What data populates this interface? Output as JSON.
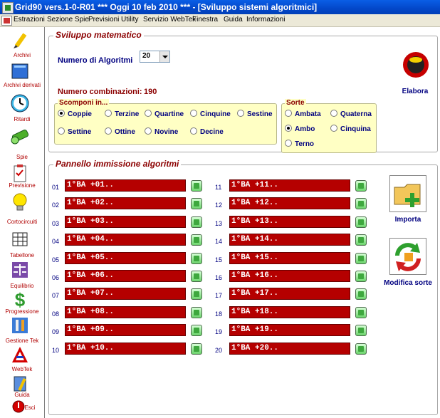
{
  "window": {
    "title": "Grid90 vers.1-0-R01  ***  Oggi 10 feb 2010  ***   - [Sviluppo sistemi algoritmici]"
  },
  "menu": [
    "Estrazioni",
    "Sezione Spie",
    "Previsioni",
    "Utility",
    "Servizio WebTek",
    "Finestra",
    "Guida",
    "Informazioni"
  ],
  "sidebar": [
    {
      "label": "Archivi",
      "icon": "pencil-icon"
    },
    {
      "label": "Archivi derivati",
      "icon": "book-icon"
    },
    {
      "label": "Ritardi",
      "icon": "clock-icon"
    },
    {
      "label": "Spie",
      "icon": "spyglass-icon"
    },
    {
      "label": "Previsione",
      "icon": "clipboard-icon"
    },
    {
      "label": "Cortocircuiti",
      "icon": "lightbulb-icon"
    },
    {
      "label": "Tabellone",
      "icon": "table-icon"
    },
    {
      "label": "Equilibrio",
      "icon": "scale-icon"
    },
    {
      "label": "Progressione",
      "icon": "dollar-icon"
    },
    {
      "label": "Gestione Tek",
      "icon": "tools-icon"
    },
    {
      "label": "WebTek",
      "icon": "webtek-logo-icon"
    },
    {
      "label": "Guida",
      "icon": "guide-icon"
    },
    {
      "label": "Esci",
      "icon": "exit-icon"
    }
  ],
  "sviluppo": {
    "title": "Sviluppo matematico",
    "num_algoritmi_label": "Numero di Algoritmi",
    "num_algoritmi_value": "20",
    "combinazioni_label": "Numero combinazioni:",
    "combinazioni_value": "190",
    "elabora_label": "Elabora",
    "scomponi": {
      "title": "Scomponi in...",
      "options": [
        "Coppie",
        "Terzine",
        "Quartine",
        "Cinquine",
        "Sestine",
        "Settine",
        "Ottine",
        "Novine",
        "Decine"
      ],
      "selected": "Coppie"
    },
    "sorte": {
      "title": "Sorte",
      "options": [
        "Ambata",
        "Quaterna",
        "Ambo",
        "Cinquina",
        "Terno"
      ],
      "selected": "Ambo"
    }
  },
  "pannello": {
    "title": "Pannello immissione algoritmi",
    "rows": [
      {
        "num": "01",
        "value": "1°BA +01.."
      },
      {
        "num": "02",
        "value": "1°BA +02.."
      },
      {
        "num": "03",
        "value": "1°BA +03.."
      },
      {
        "num": "04",
        "value": "1°BA +04.."
      },
      {
        "num": "05",
        "value": "1°BA +05.."
      },
      {
        "num": "06",
        "value": "1°BA +06.."
      },
      {
        "num": "07",
        "value": "1°BA +07.."
      },
      {
        "num": "08",
        "value": "1°BA +08.."
      },
      {
        "num": "09",
        "value": "1°BA +09.."
      },
      {
        "num": "10",
        "value": "1°BA +10.."
      },
      {
        "num": "11",
        "value": "1°BA +11.."
      },
      {
        "num": "12",
        "value": "1°BA +12.."
      },
      {
        "num": "13",
        "value": "1°BA +13.."
      },
      {
        "num": "14",
        "value": "1°BA +14.."
      },
      {
        "num": "15",
        "value": "1°BA +15.."
      },
      {
        "num": "16",
        "value": "1°BA +16.."
      },
      {
        "num": "17",
        "value": "1°BA +17.."
      },
      {
        "num": "18",
        "value": "1°BA +18.."
      },
      {
        "num": "19",
        "value": "1°BA +19.."
      },
      {
        "num": "20",
        "value": "1°BA +20.."
      }
    ],
    "importa_label": "Importa",
    "modifica_label": "Modifica sorte"
  }
}
